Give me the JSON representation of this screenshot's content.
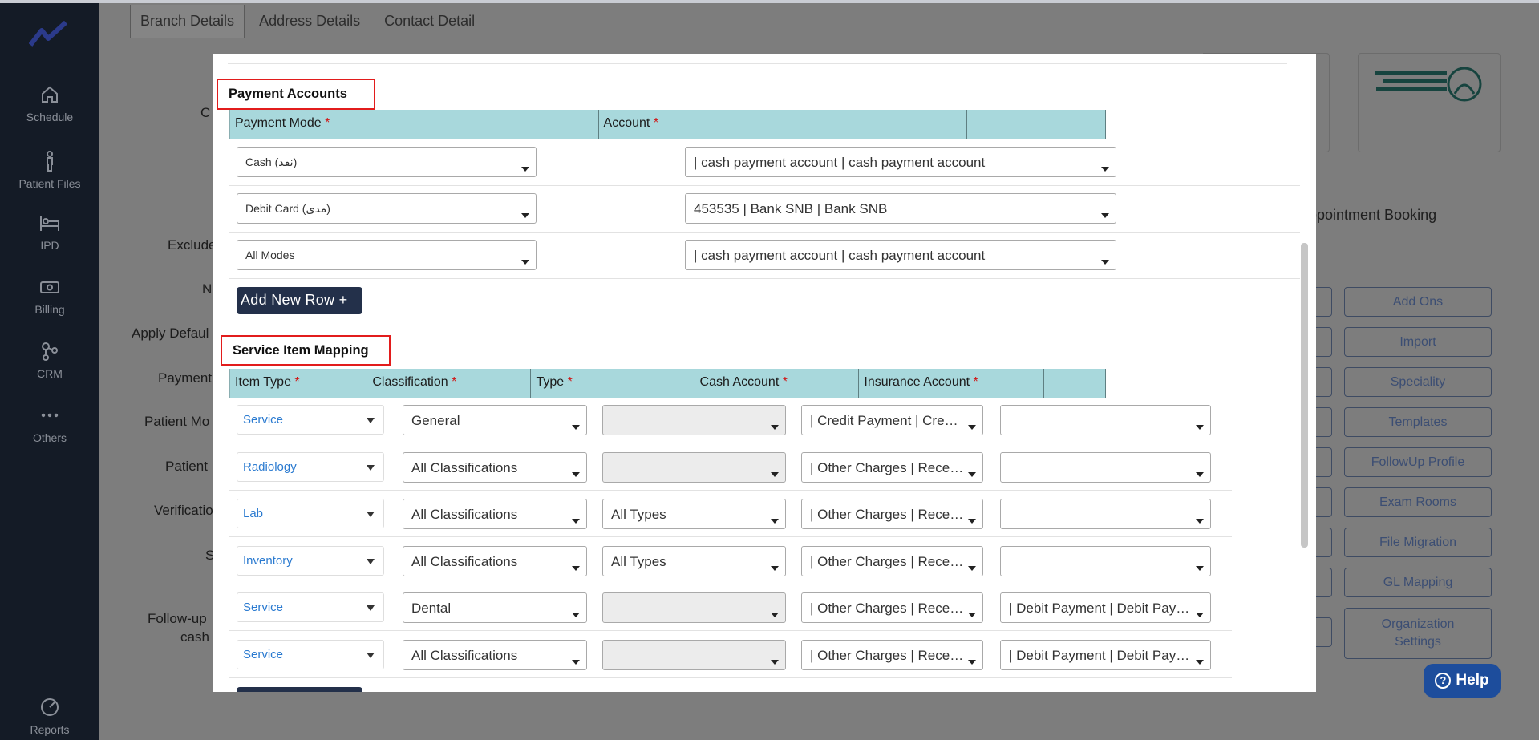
{
  "sidebar": {
    "items": [
      {
        "label": "Schedule",
        "icon": "home-icon"
      },
      {
        "label": "Patient Files",
        "icon": "person-icon"
      },
      {
        "label": "IPD",
        "icon": "bed-icon"
      },
      {
        "label": "Billing",
        "icon": "cash-icon"
      },
      {
        "label": "CRM",
        "icon": "network-icon"
      },
      {
        "label": "Others",
        "icon": "dots-icon"
      },
      {
        "label": "Reports",
        "icon": "chart-icon"
      }
    ]
  },
  "background": {
    "tabs": [
      "Branch Details",
      "Address Details",
      "Contact Detail"
    ],
    "labels": [
      "C",
      "Exclude",
      "N",
      "Apply Defaul",
      "Payment",
      "Patient Mo",
      "Patient",
      "Verificatio",
      "S",
      "Follow-up",
      "cash"
    ],
    "appointment_booking": "ppointment Booking",
    "buttons": [
      "Add Ons",
      "Import",
      "Speciality",
      "Templates",
      "FollowUp Profile",
      "Exam Rooms",
      "File Migration",
      "GL Mapping",
      "Organization Settings"
    ],
    "help_label": "Help"
  },
  "payment_accounts": {
    "title": "Payment Accounts",
    "columns": {
      "mode": "Payment Mode",
      "account": "Account"
    },
    "rows": [
      {
        "mode": "Cash (نقد)",
        "account": "| cash payment account | cash payment account"
      },
      {
        "mode": "Debit Card (مدى)",
        "account": "453535 | Bank SNB | Bank SNB"
      },
      {
        "mode": "All Modes",
        "account": "| cash payment account | cash payment account"
      }
    ],
    "add_row_label": "Add New Row +"
  },
  "service_item_mapping": {
    "title": "Service Item Mapping",
    "columns": {
      "item_type": "Item Type",
      "classification": "Classification",
      "type": "Type",
      "cash_account": "Cash Account",
      "insurance_account": "Insurance Account"
    },
    "required_mark": "*",
    "rows": [
      {
        "item_type": "Service",
        "classification": "General",
        "type": "",
        "cash_account": "| Credit Payment | Credit Payment",
        "insurance_account": ""
      },
      {
        "item_type": "Radiology",
        "classification": "All Classifications",
        "type": "",
        "cash_account": "| Other Charges | Receivable",
        "insurance_account": ""
      },
      {
        "item_type": "Lab",
        "classification": "All Classifications",
        "type": "All Types",
        "cash_account": "| Other Charges | Receivable",
        "insurance_account": ""
      },
      {
        "item_type": "Inventory",
        "classification": "All Classifications",
        "type": "All Types",
        "cash_account": "| Other Charges | Receivable",
        "insurance_account": ""
      },
      {
        "item_type": "Service",
        "classification": "Dental",
        "type": "",
        "cash_account": "| Other Charges | Receivable",
        "insurance_account": "| Debit Payment | Debit Payment"
      },
      {
        "item_type": "Service",
        "classification": "All Classifications",
        "type": "",
        "cash_account": "| Other Charges | Receivable",
        "insurance_account": "| Debit Payment | Debit Payment"
      }
    ],
    "disabled_type_rows": [
      0,
      1,
      4,
      5
    ]
  }
}
